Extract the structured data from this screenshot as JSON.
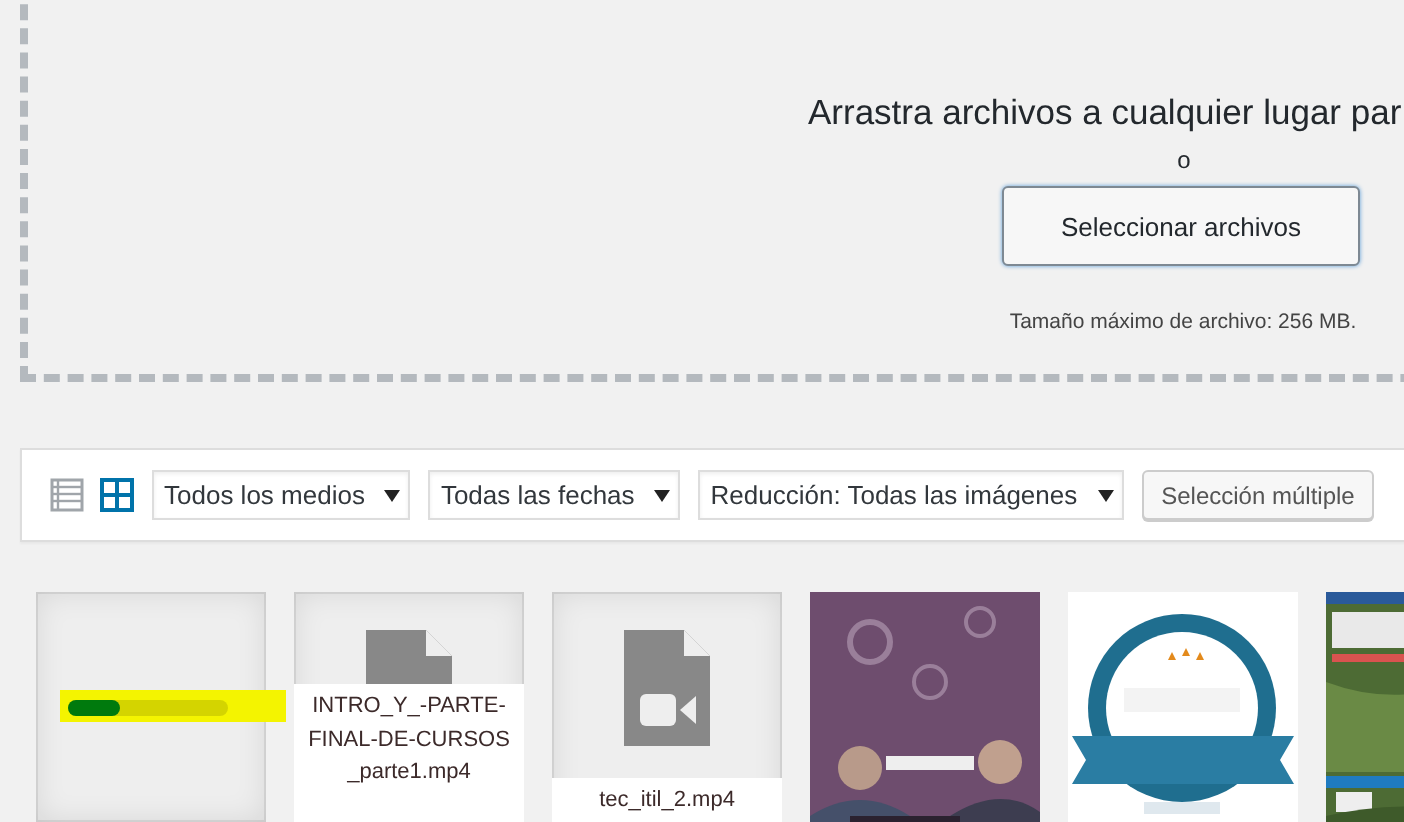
{
  "upload": {
    "title": "Arrastra archivos a cualquier lugar par",
    "separator": "o",
    "button": "Seleccionar archivos",
    "max_size": "Tamaño máximo de archivo: 256 MB."
  },
  "toolbar": {
    "views": [
      {
        "kind": "list",
        "selected": false
      },
      {
        "kind": "grid",
        "selected": true
      }
    ],
    "filters": [
      {
        "value": "Todos los medios"
      },
      {
        "value": "Todas las fechas"
      },
      {
        "value": "Reducción: Todas las imágenes"
      }
    ],
    "bulk_button": "Selección múltiple"
  },
  "items": [
    {
      "kind": "uploading",
      "level": 0.33
    },
    {
      "kind": "video",
      "filename": "INTRO_Y_-PARTE-FINAL-DE-CURSOS_parte1.mp4"
    },
    {
      "kind": "video",
      "filename": "tec_itil_2.mp4"
    },
    {
      "kind": "picture"
    },
    {
      "kind": "picture"
    },
    {
      "kind": "picture"
    }
  ]
}
